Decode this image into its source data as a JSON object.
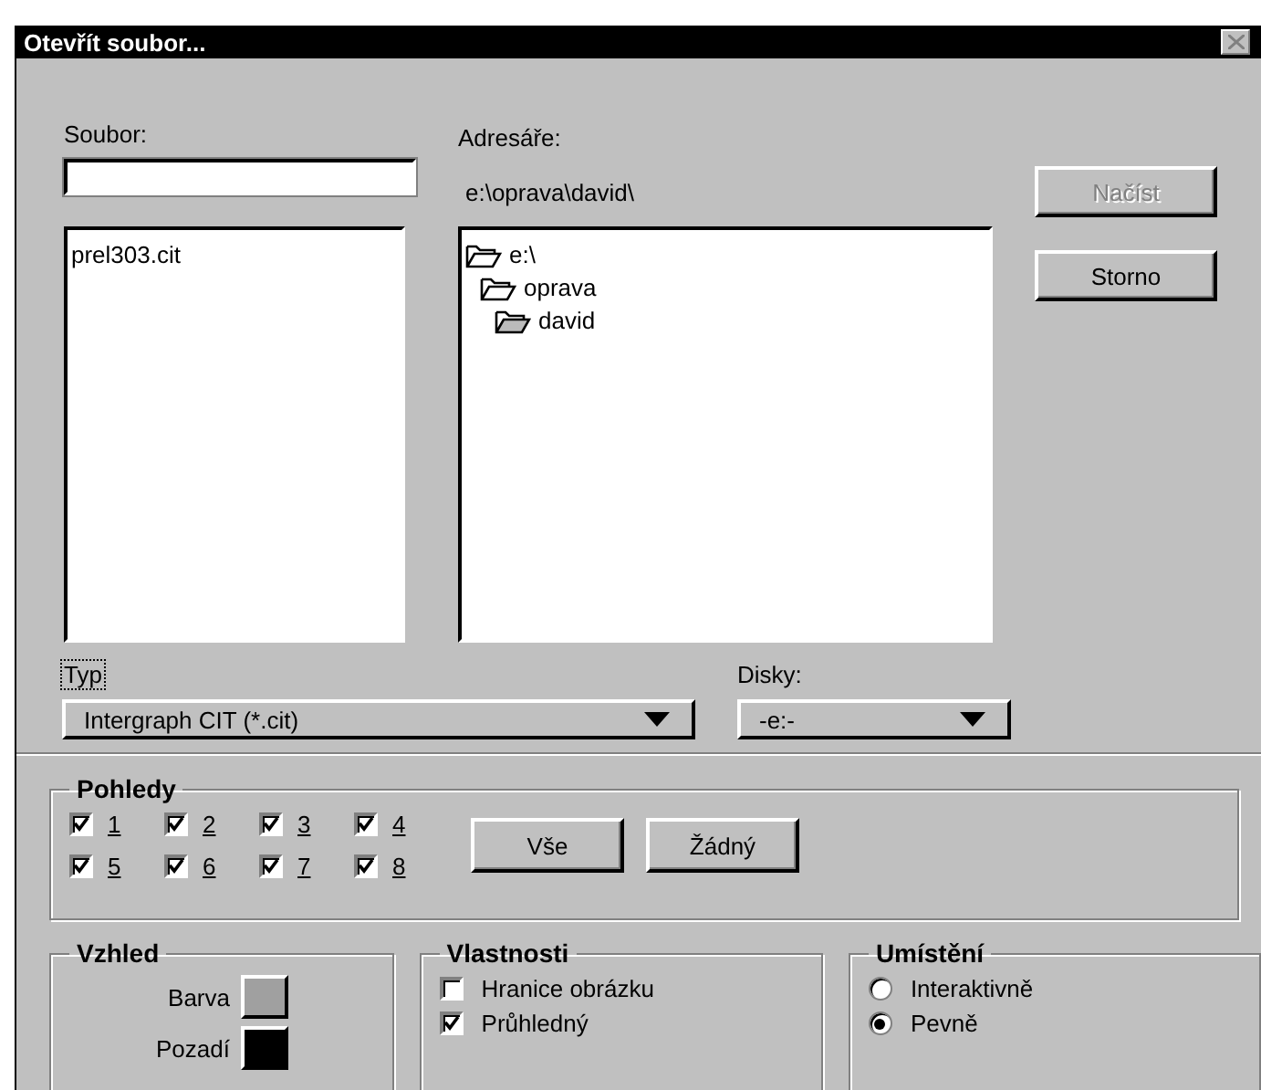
{
  "window": {
    "title": "Otevřít soubor..."
  },
  "file_name": {
    "label": "Soubor:"
  },
  "files": [
    {
      "name": "prel303.cit"
    }
  ],
  "directories": {
    "label": "Adresáře:",
    "path": "e:\\oprava\\david\\",
    "tree": [
      {
        "name": "e:\\",
        "selected": false,
        "children": [
          {
            "name": "oprava",
            "selected": false,
            "children": [
              {
                "name": "david",
                "selected": true
              }
            ]
          }
        ]
      }
    ]
  },
  "buttons": [
    {
      "label": "Načíst",
      "disabled": true
    },
    {
      "label": "Storno",
      "disabled": false
    }
  ],
  "type": {
    "label": "Typ",
    "value": "Intergraph CIT (*.cit)",
    "focused": true
  },
  "drives": {
    "label": "Disky:",
    "value": "-e:-",
    "focused": false
  },
  "views": {
    "title": "Pohledy",
    "items": [
      {
        "label": "1",
        "checked": true
      },
      {
        "label": "2",
        "checked": true
      },
      {
        "label": "3",
        "checked": true
      },
      {
        "label": "4",
        "checked": true
      },
      {
        "label": "5",
        "checked": true
      },
      {
        "label": "6",
        "checked": true
      },
      {
        "label": "7",
        "checked": true
      },
      {
        "label": "8",
        "checked": true
      }
    ],
    "buttons": [
      "Vše",
      "Žádný"
    ]
  },
  "appearance": {
    "title": "Vzhled",
    "swatches": [
      {
        "label": "Barva",
        "color": "#a0a0a0"
      },
      {
        "label": "Pozadí",
        "color": "#000000"
      }
    ]
  },
  "properties": {
    "title": "Vlastnosti",
    "options": [
      {
        "label": "Hranice obrázku",
        "checked": false
      },
      {
        "label": "Průhledný",
        "checked": true
      }
    ]
  },
  "placement": {
    "title": "Umístění",
    "options": [
      {
        "label": "Interaktivně",
        "selected": false
      },
      {
        "label": "Pevně",
        "selected": true
      }
    ]
  }
}
